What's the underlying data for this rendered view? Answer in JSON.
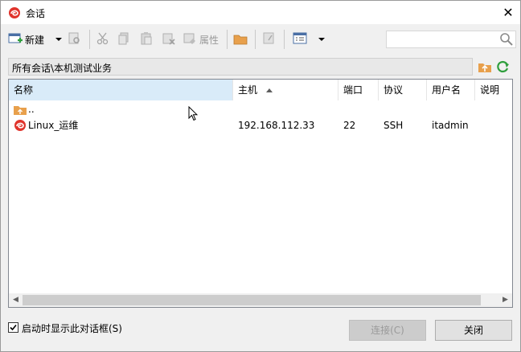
{
  "window": {
    "title": "会话",
    "close_glyph": "✕"
  },
  "toolbar": {
    "new_label": "新建",
    "properties_label": "属性",
    "icons": [
      "new-session-icon",
      "find-icon",
      "cut-icon",
      "copy-icon",
      "paste-icon",
      "delete-icon",
      "properties-icon",
      "open-folder-icon",
      "window-icon",
      "view-icon"
    ]
  },
  "search": {
    "value": "",
    "placeholder": ""
  },
  "path": {
    "text": "所有会话\\本机测试业务"
  },
  "columns": {
    "name": "名称",
    "host": "主机",
    "port": "端口",
    "protocol": "协议",
    "username": "用户名",
    "description": "说明"
  },
  "rows": [
    {
      "name": "..",
      "host": "",
      "port": "",
      "protocol": "",
      "username": "",
      "description": "",
      "icon": "parent-folder-icon"
    },
    {
      "name": "Linux_运维",
      "host": "192.168.112.33",
      "port": "22",
      "protocol": "SSH",
      "username": "itadmin",
      "description": "",
      "icon": "session-icon"
    }
  ],
  "footer": {
    "startup_checkbox_label": "启动时显示此对话框(S)",
    "startup_checked": true,
    "connect_label": "连接(C)",
    "close_label": "关闭"
  },
  "colors": {
    "accent_red": "#e0342c",
    "selected_header": "#d9ebf9",
    "folder_orange": "#e8a04c",
    "refresh_green": "#2e9e3c"
  }
}
